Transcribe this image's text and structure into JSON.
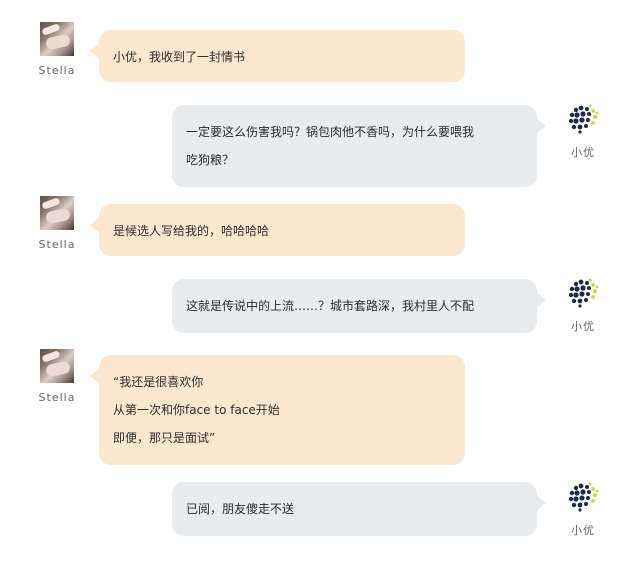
{
  "participants": {
    "left_name": "Stella",
    "right_name": "小优"
  },
  "messages": [
    {
      "side": "left",
      "lines": [
        "小优，我收到了一封情书"
      ]
    },
    {
      "side": "right",
      "lines": [
        "一定要这么伤害我吗？锅包肉他不香吗，为什么要喂我",
        "吃狗粮？"
      ]
    },
    {
      "side": "left",
      "lines": [
        "是候选人写给我的，哈哈哈哈"
      ]
    },
    {
      "side": "right",
      "lines": [
        "这就是传说中的上流……？城市套路深，我村里人不配"
      ]
    },
    {
      "side": "left",
      "lines": [
        "“我还是很喜欢你",
        "从第一次和你face to face开始",
        "即便，那只是面试”"
      ]
    },
    {
      "side": "right",
      "lines": [
        "已阅，朋友傻走不送"
      ]
    }
  ],
  "colors": {
    "left_bubble": "#fde8cf",
    "right_bubble": "#e8ecef"
  },
  "icons": {
    "left_avatar": "stella-avatar-photo",
    "right_avatar": "xiaoyou-dotted-globe-logo"
  }
}
